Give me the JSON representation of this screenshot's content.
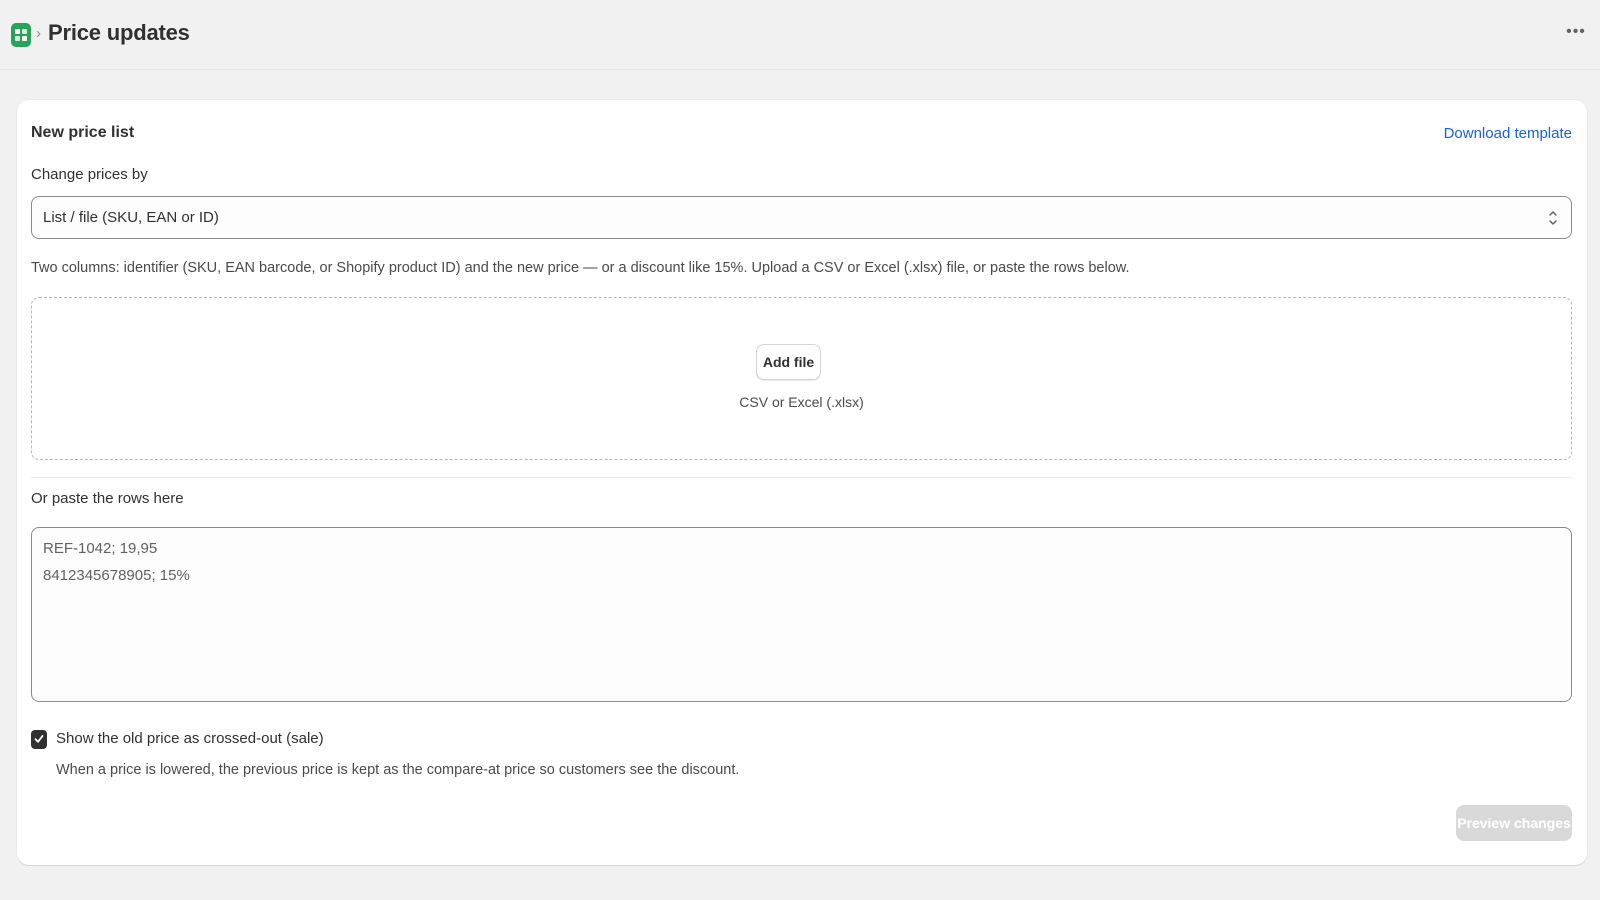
{
  "header": {
    "app_icon": "app-logo-icon",
    "separator": "›",
    "title": "Price updates",
    "more_label": "•••"
  },
  "card": {
    "title": "New price list",
    "download_template": "Download template",
    "change_by": {
      "label": "Change prices by",
      "selected": "List / file (SKU, EAN or ID)"
    },
    "help_text": "Two columns: identifier (SKU, EAN barcode, or Shopify product ID) and the new price — or a discount like 15%. Upload a CSV or Excel (.xlsx) file, or paste the rows below.",
    "dropzone": {
      "button": "Add file",
      "hint": "CSV or Excel (.xlsx)"
    },
    "paste": {
      "label": "Or paste the rows here",
      "placeholder_lines": [
        "REF-1042; 19,95",
        "8412345678905; 15%"
      ]
    },
    "sale_option": {
      "checked": true,
      "label": "Show the old price as crossed-out (sale)",
      "help": "When a price is lowered, the previous price is kept as the compare-at price so customers see the discount."
    },
    "preview_button": "Preview changes"
  },
  "colors": {
    "accent_link": "#1a62d6",
    "app_icon": "#29a35a",
    "checkbox": "#303030",
    "disabled_button": "#d9d9d9"
  }
}
